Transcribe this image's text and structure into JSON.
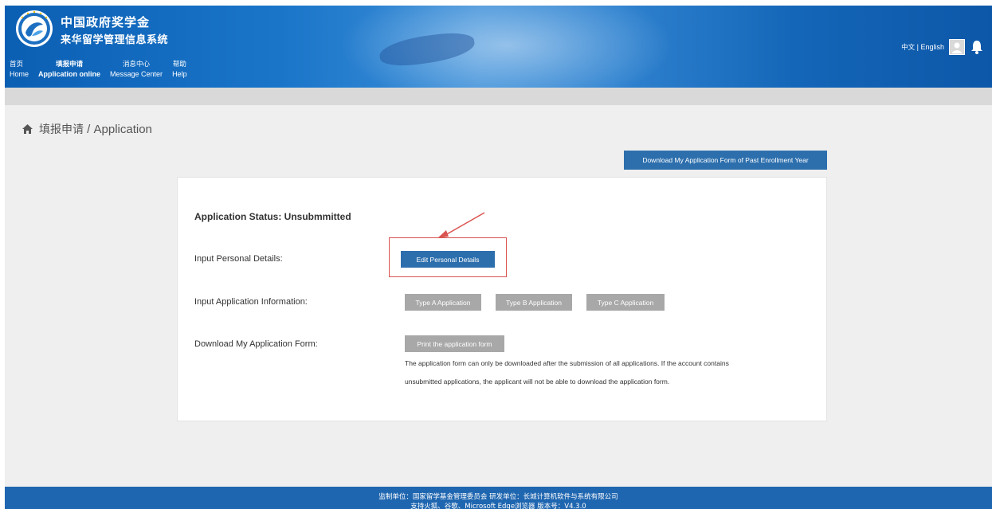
{
  "header": {
    "title_line1": "中国政府奖学金",
    "title_line2": "来华留学管理信息系统",
    "nav": [
      {
        "zh": "首页",
        "en": "Home"
      },
      {
        "zh": "填报申请",
        "en": "Application online"
      },
      {
        "zh": "消息中心",
        "en": "Message Center"
      },
      {
        "zh": "帮助",
        "en": "Help"
      }
    ],
    "lang_zh": "中文",
    "lang_sep": " | ",
    "lang_en": "English",
    "colors": {
      "header_blue": "#1a75c9",
      "button_blue": "#2d6fad",
      "button_gray": "#a8a8a8",
      "highlight_red": "#d9534f"
    }
  },
  "breadcrumb": {
    "zh": "填报申请",
    "sep": " / ",
    "en": "Application"
  },
  "main": {
    "past_button": "Download My Application Form of Past Enrollment Year",
    "status_title": "Application Status: Unsubmmitted",
    "rows": {
      "personal_label": "Input Personal Details:",
      "personal_button": "Edit Personal Details",
      "application_label": "Input Application Information:",
      "type_a": "Type A Application",
      "type_b": "Type B Application",
      "type_c": "Type C Application",
      "download_label": "Download My Application Form:",
      "print_button": "Print the application form",
      "note_line1": "The application form can only be downloaded after the submission of all applications. If the account contains",
      "note_line2": "unsubmitted applications, the applicant will not be able to download the application form."
    }
  },
  "footer": {
    "line1": "监制单位：国家留学基金管理委员会    研发单位：长城计算机软件与系统有限公司",
    "line2": "支持火狐、谷歌、Microsoft Edge浏览器    版本号：V4.3.0"
  }
}
